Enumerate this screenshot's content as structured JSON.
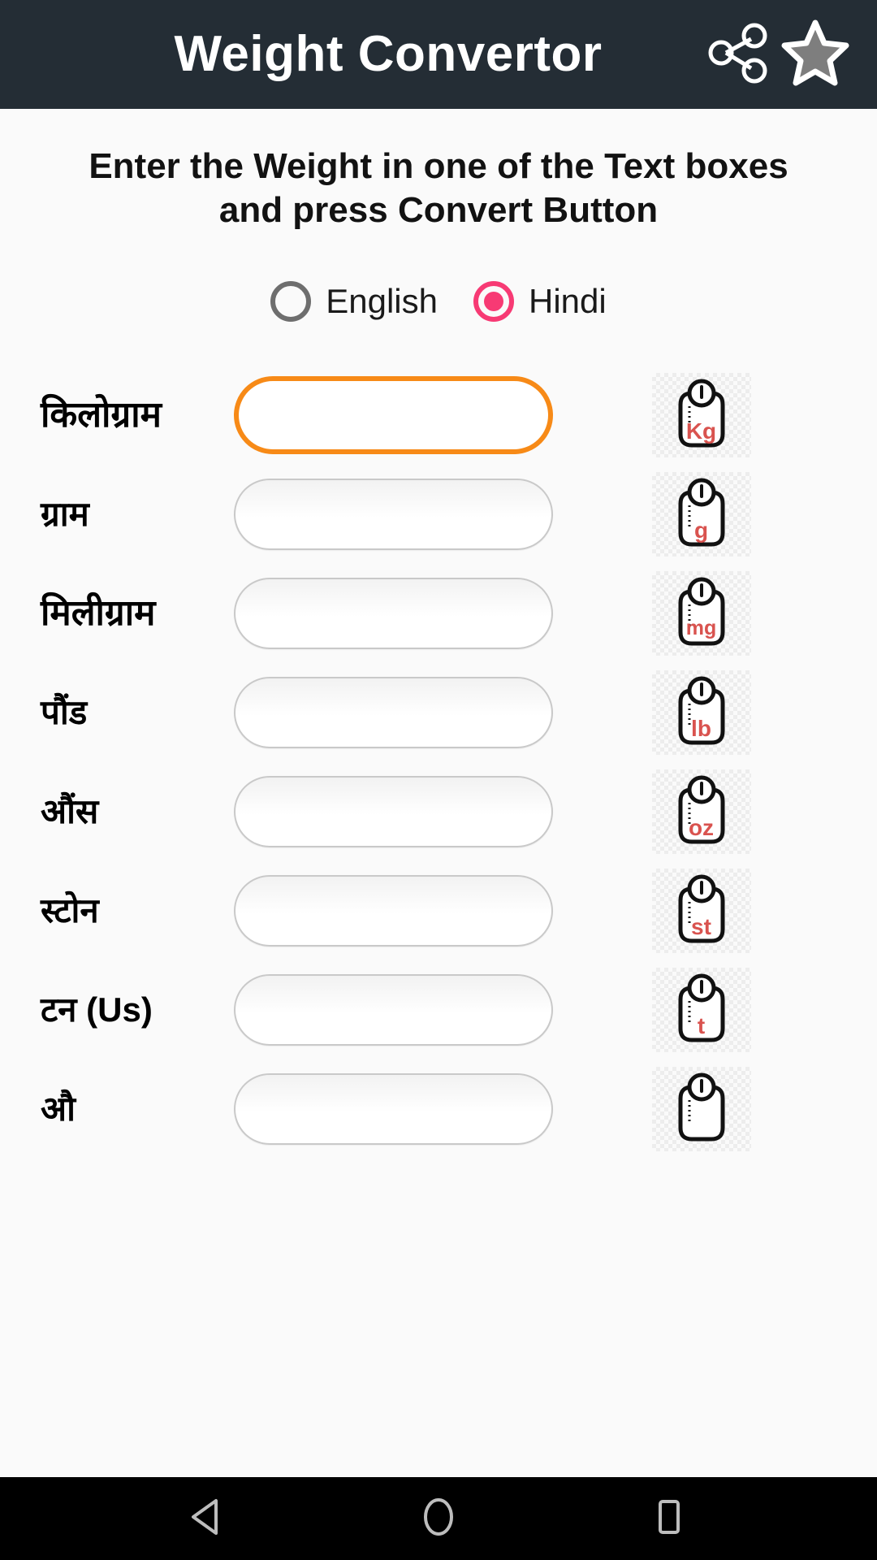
{
  "appbar": {
    "title": "Weight Convertor",
    "share_icon": "share-icon",
    "favorite_icon": "star-icon"
  },
  "instruction": "Enter the Weight in one of the Text boxes and press Convert Button",
  "language": {
    "options": [
      {
        "label": "English",
        "selected": false
      },
      {
        "label": "Hindi",
        "selected": true
      }
    ],
    "selected_color": "#F73A74",
    "unselected_color": "#6E6E6E"
  },
  "theme": {
    "appbar_bg": "#242D35",
    "page_bg": "#FAFAFA",
    "focus_border": "#F78A17",
    "unit_text": "#D9534F",
    "navbar_bg": "#000000"
  },
  "rows": [
    {
      "label": "किलोग्राम",
      "unit": "Kg",
      "value": "",
      "placeholder": "",
      "focused": true
    },
    {
      "label": "ग्राम",
      "unit": "g",
      "value": "",
      "placeholder": "",
      "focused": false
    },
    {
      "label": "मिलीग्राम",
      "unit": "mg",
      "value": "",
      "placeholder": "",
      "focused": false
    },
    {
      "label": "पौंड",
      "unit": "lb",
      "value": "",
      "placeholder": "",
      "focused": false
    },
    {
      "label": "औंस",
      "unit": "oz",
      "value": "",
      "placeholder": "",
      "focused": false
    },
    {
      "label": "स्टोन",
      "unit": "st",
      "value": "",
      "placeholder": "",
      "focused": false
    },
    {
      "label": "टन (Us)",
      "unit": "t",
      "value": "",
      "placeholder": "",
      "focused": false
    },
    {
      "label": "औ",
      "unit": "",
      "value": "",
      "placeholder": "",
      "focused": false
    }
  ],
  "navbar": {
    "back": "back-triangle-icon",
    "home": "home-circle-icon",
    "recents": "recents-square-icon"
  }
}
